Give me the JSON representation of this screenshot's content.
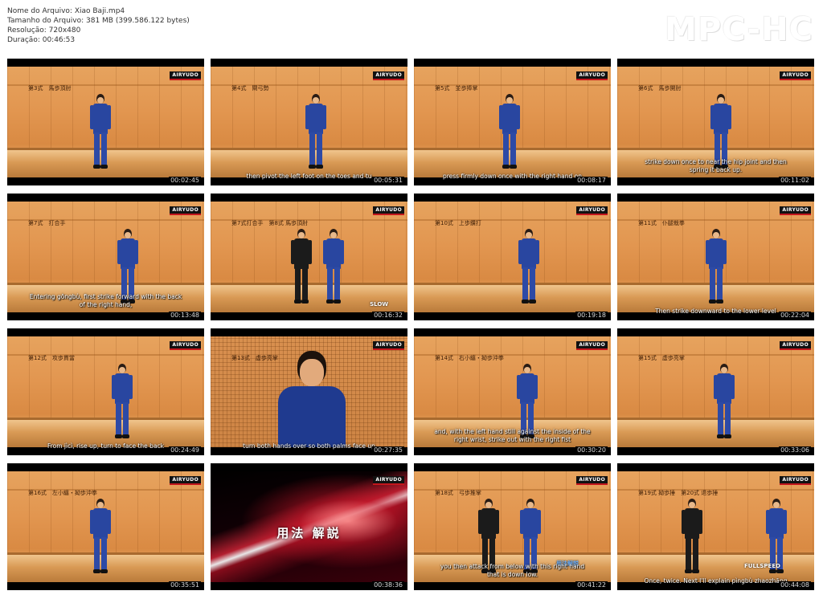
{
  "file_info": {
    "name": "Nome do Arquivo: Xiao Baji.mp4",
    "size": "Tamanho do Arquivo: 381 MB (399.586.122 bytes)",
    "resolution": "Resolução: 720x480",
    "duration": "Duração: 00:46:53"
  },
  "logo": "MPC-HC",
  "badge": "AIRYUDO",
  "thumbnails": [
    {
      "title": "第3式　馬歩頂肘",
      "subtitle": "",
      "tag": "",
      "time": "00:02:45"
    },
    {
      "title": "第4式　閘弓勢",
      "subtitle": "then pivot the left foot on the toes and tu",
      "tag": "",
      "time": "00:05:31"
    },
    {
      "title": "第5式　並歩捧掌",
      "subtitle": "press firmly down once with the right hand on",
      "tag": "",
      "time": "00:08:17"
    },
    {
      "title": "第6式　馬歩開肘",
      "subtitle": "strike down once to near the hip joint and then\nspring it back up.",
      "tag": "",
      "time": "00:11:02"
    },
    {
      "title": "第7式　打合手",
      "subtitle": "Entering gōngbù, first strike forward with the back\nof the right hand,",
      "tag": "",
      "time": "00:13:48"
    },
    {
      "title": "第7式打合手　第8式 馬歩頂肘",
      "subtitle": "",
      "tag": "SLOW",
      "time": "00:16:32"
    },
    {
      "title": "第10式　上歩鑽打",
      "subtitle": "",
      "tag": "",
      "time": "00:19:18"
    },
    {
      "title": "第11式　仆腿栽拳",
      "subtitle": "Then strike downward to the lower level",
      "tag": "",
      "time": "00:22:04"
    },
    {
      "title": "第12式　攻歩貫當",
      "subtitle": "From jìcì, rise up, turn to face the back",
      "tag": "",
      "time": "00:24:49"
    },
    {
      "title": "第13式　虚歩亮掌",
      "subtitle": "turn both hands over so both palms face up",
      "tag": "",
      "time": "00:27:35"
    },
    {
      "title": "第14式　右小纏・拗歩沖拳",
      "subtitle": "and, with the left hand still against the inside of the\nright wrist, strike out with the right fist",
      "tag": "",
      "time": "00:30:20"
    },
    {
      "title": "第15式　虚歩亮掌",
      "subtitle": "",
      "tag": "",
      "time": "00:33:06"
    },
    {
      "title": "第16式　左小纏・拗歩沖拳",
      "subtitle": "",
      "tag": "",
      "time": "00:35:51"
    },
    {
      "title": "用法 解説",
      "subtitle": "",
      "tag": "",
      "time": "00:38:36"
    },
    {
      "title": "第18式　弓歩推掌",
      "subtitle": "you then attack from below with this right hand\nthat is down low.",
      "tag": "用法解説",
      "time": "00:41:22"
    },
    {
      "title": "第19式 拗歩捶　第20式 退歩捶",
      "subtitle": "Once, twice. Next I'll explain pìngbù zhaozhāng",
      "tag": "FULLSPEED",
      "time": "00:44:08"
    }
  ]
}
